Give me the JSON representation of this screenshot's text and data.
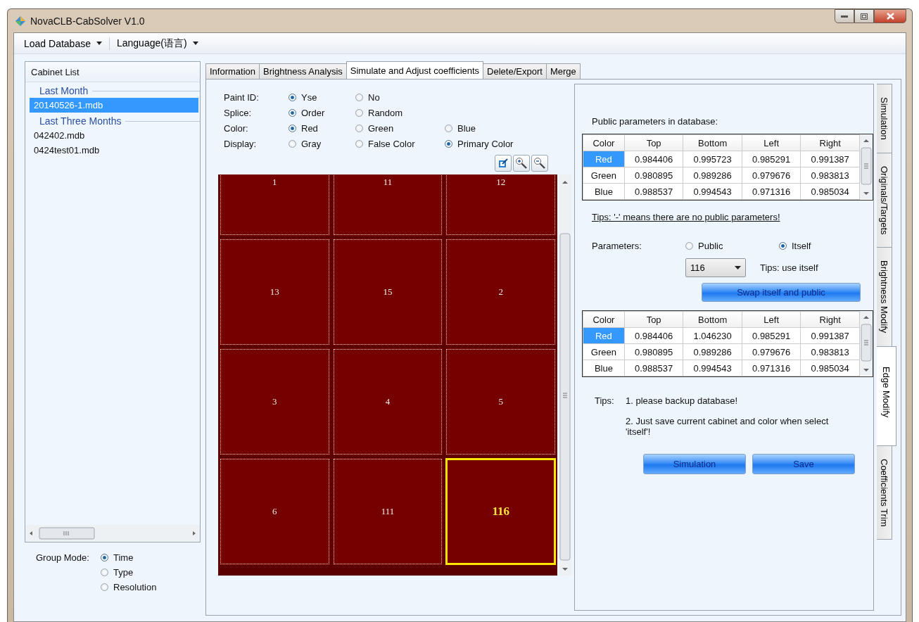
{
  "window": {
    "title": "NovaCLB-CabSolver V1.0"
  },
  "menu": [
    {
      "label": "Load Database"
    },
    {
      "label": "Language(语言)"
    }
  ],
  "cabinet_list": {
    "header": "Cabinet List",
    "groups": [
      {
        "label": "Last Month",
        "items": [
          {
            "label": "20140526-1.mdb",
            "selected": true
          }
        ]
      },
      {
        "label": "Last Three Months",
        "items": [
          {
            "label": "042402.mdb",
            "selected": false
          },
          {
            "label": "0424test01.mdb",
            "selected": false
          }
        ]
      }
    ]
  },
  "group_mode": {
    "label": "Group Mode:",
    "options": [
      {
        "label": "Time",
        "selected": true
      },
      {
        "label": "Type",
        "selected": false
      },
      {
        "label": "Resolution",
        "selected": false
      }
    ]
  },
  "tabs": [
    {
      "label": "Information",
      "selected": false
    },
    {
      "label": "Brightness Analysis",
      "selected": false
    },
    {
      "label": "Simulate and Adjust coefficients",
      "selected": true
    },
    {
      "label": "Delete/Export",
      "selected": false
    },
    {
      "label": "Merge",
      "selected": false
    }
  ],
  "options": [
    {
      "label": "Paint ID:",
      "choices": [
        {
          "label": "Yse",
          "selected": true
        },
        {
          "label": "No",
          "selected": false
        }
      ]
    },
    {
      "label": "Splice:",
      "choices": [
        {
          "label": "Order",
          "selected": true
        },
        {
          "label": "Random",
          "selected": false
        }
      ]
    },
    {
      "label": "Color:",
      "choices": [
        {
          "label": "Red",
          "selected": true
        },
        {
          "label": "Green",
          "selected": false
        },
        {
          "label": "Blue",
          "selected": false
        }
      ]
    },
    {
      "label": "Display:",
      "choices": [
        {
          "label": "Gray",
          "selected": false
        },
        {
          "label": "False Color",
          "selected": false
        },
        {
          "label": "Primary Color",
          "selected": true
        }
      ]
    }
  ],
  "cabinets": [
    {
      "label": "1",
      "selected": false
    },
    {
      "label": "11",
      "selected": false
    },
    {
      "label": "12",
      "selected": false
    },
    {
      "label": "13",
      "selected": false
    },
    {
      "label": "15",
      "selected": false
    },
    {
      "label": "2",
      "selected": false
    },
    {
      "label": "3",
      "selected": false
    },
    {
      "label": "4",
      "selected": false
    },
    {
      "label": "5",
      "selected": false
    },
    {
      "label": "6",
      "selected": false
    },
    {
      "label": "111",
      "selected": false
    },
    {
      "label": "116",
      "selected": true
    }
  ],
  "public_parameters": {
    "title": "Public parameters in database:",
    "columns": [
      "Color",
      "Top",
      "Bottom",
      "Left",
      "Right"
    ],
    "rows": [
      {
        "cells": [
          "Red",
          "0.984406",
          "0.995723",
          "0.985291",
          "0.991387"
        ],
        "selected": true
      },
      {
        "cells": [
          "Green",
          "0.980895",
          "0.989286",
          "0.979676",
          "0.983813"
        ],
        "selected": false
      },
      {
        "cells": [
          "Blue",
          "0.988537",
          "0.994543",
          "0.971316",
          "0.985034"
        ],
        "selected": false
      }
    ]
  },
  "public_tip": "Tips: '-' means there are no public parameters!",
  "parameters": {
    "label": "Parameters:",
    "choices": [
      {
        "label": "Public",
        "selected": false
      },
      {
        "label": "Itself",
        "selected": true
      }
    ],
    "dropdown": "116",
    "tip": "Tips: use itself",
    "swap_button": "Swap itself and public"
  },
  "current_parameters": {
    "columns": [
      "Color",
      "Top",
      "Bottom",
      "Left",
      "Right"
    ],
    "rows": [
      {
        "cells": [
          "Red",
          "0.984406",
          "1.046230",
          "0.985291",
          "0.991387"
        ],
        "selected": true
      },
      {
        "cells": [
          "Green",
          "0.980895",
          "0.989286",
          "0.979676",
          "0.983813"
        ],
        "selected": false
      },
      {
        "cells": [
          "Blue",
          "0.988537",
          "0.994543",
          "0.971316",
          "0.985034"
        ],
        "selected": false
      }
    ]
  },
  "tips": {
    "label": "Tips:",
    "lines": [
      "1. please backup database!",
      "2. Just save current cabinet and color when select 'itself'!"
    ]
  },
  "buttons": [
    "Simulation",
    "Save"
  ],
  "side_tabs": [
    {
      "label": "Simulation",
      "selected": false
    },
    {
      "label": "Originals/Targets",
      "selected": false
    },
    {
      "label": "Brightness Modify",
      "selected": false
    },
    {
      "label": "Edge Modify",
      "selected": true
    },
    {
      "label": "Coefficients Trim",
      "selected": false
    }
  ]
}
